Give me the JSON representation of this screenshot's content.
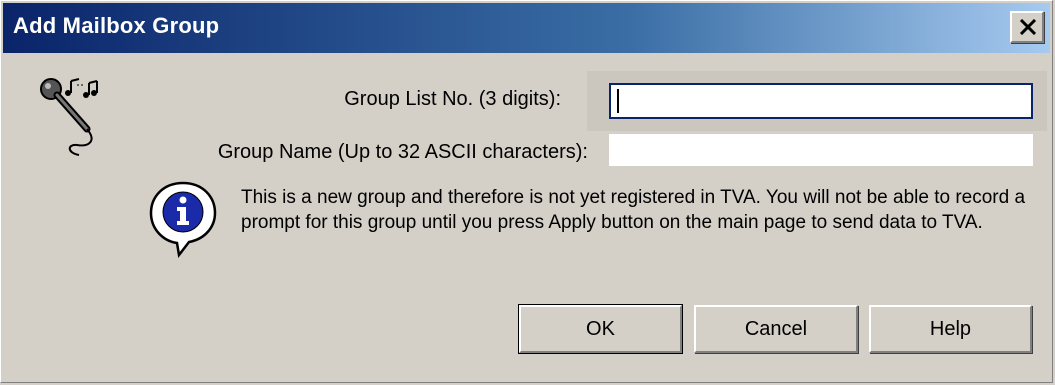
{
  "window": {
    "title": "Add Mailbox Group",
    "close_glyph": "×"
  },
  "icons": {
    "top_left": "microphone-music-icon",
    "info": "info-speech-bubble-icon"
  },
  "form": {
    "group_list_no_label": "Group List No. (3 digits):",
    "group_list_no_value": "",
    "group_name_label": "Group Name (Up to 32 ASCII characters):",
    "group_name_value": ""
  },
  "message": {
    "text": "This is a new group and therefore is not yet registered in TVA. You will not be able to record a prompt for this group until you press Apply button on the main page to send data to TVA."
  },
  "buttons": {
    "ok": "OK",
    "cancel": "Cancel",
    "help": "Help"
  },
  "colors": {
    "title_bar_start": "#0a246a",
    "title_bar_end": "#a6caf0",
    "dialog_bg": "#d4d0c8"
  }
}
